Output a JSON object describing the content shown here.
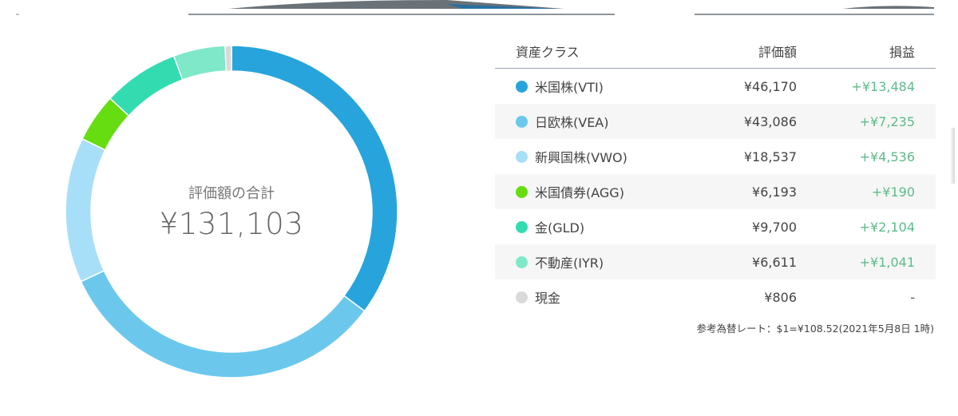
{
  "chart_data": {
    "type": "pie",
    "title": "",
    "center_label": "評価額の合計",
    "center_value": "¥131,103",
    "categories": [
      "米国株(VTI)",
      "日欧株(VEA)",
      "新興国株(VWO)",
      "米国債券(AGG)",
      "金(GLD)",
      "不動産(IYR)",
      "現金"
    ],
    "values": [
      46170,
      43086,
      18537,
      6193,
      9700,
      6611,
      806
    ],
    "colors": [
      "#27a4dc",
      "#6bc8ec",
      "#a8dff8",
      "#66dd11",
      "#33dcb0",
      "#7ee8c8",
      "#d9d9d9"
    ],
    "donut": true
  },
  "table": {
    "headers": {
      "name": "資産クラス",
      "value": "評価額",
      "gain": "損益"
    },
    "rows": [
      {
        "name": "米国株(VTI)",
        "value": "¥46,170",
        "gain": "+¥13,484",
        "color": "#27a4dc"
      },
      {
        "name": "日欧株(VEA)",
        "value": "¥43,086",
        "gain": "+¥7,235",
        "color": "#6bc8ec"
      },
      {
        "name": "新興国株(VWO)",
        "value": "¥18,537",
        "gain": "+¥4,536",
        "color": "#a8dff8"
      },
      {
        "name": "米国債券(AGG)",
        "value": "¥6,193",
        "gain": "+¥190",
        "color": "#66dd11"
      },
      {
        "name": "金(GLD)",
        "value": "¥9,700",
        "gain": "+¥2,104",
        "color": "#33dcb0"
      },
      {
        "name": "不動産(IYR)",
        "value": "¥6,611",
        "gain": "+¥1,041",
        "color": "#7ee8c8"
      },
      {
        "name": "現金",
        "value": "¥806",
        "gain": "-",
        "color": "#d9d9d9"
      }
    ]
  },
  "rate_note": "参考為替レート：$1=¥108.52(2021年5月8日 1時)"
}
